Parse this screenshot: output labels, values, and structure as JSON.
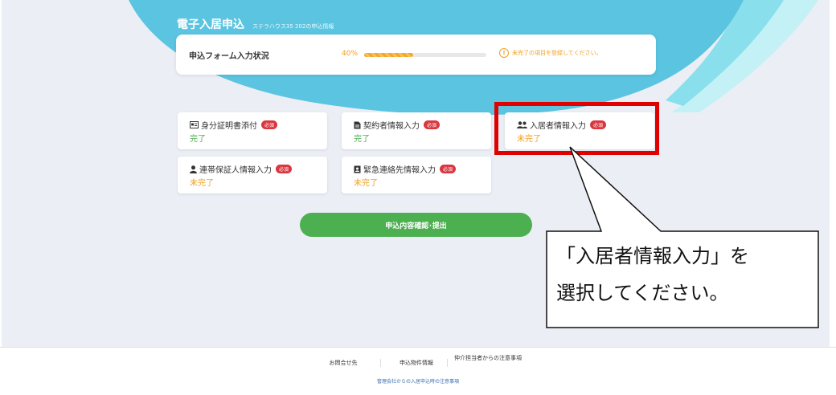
{
  "header": {
    "title": "電子入居申込",
    "subtitle": "ステラハウス35 202の申込情報"
  },
  "progress": {
    "label": "申込フォーム入力状況",
    "percent_text": "40%",
    "percent": 40,
    "warning": "未完了の項目を登録してください。"
  },
  "tasks": [
    {
      "label": "身分証明書添付",
      "badge": "必須",
      "status": "完了",
      "icon": "id-card-icon"
    },
    {
      "label": "契約者情報入力",
      "badge": "必須",
      "status": "完了",
      "icon": "document-icon"
    },
    {
      "label": "入居者情報入力",
      "badge": "必須",
      "status": "未完了",
      "icon": "users-icon"
    },
    {
      "label": "連帯保証人情報入力",
      "badge": "必須",
      "status": "未完了",
      "icon": "user-icon"
    },
    {
      "label": "緊急連絡先情報入力",
      "badge": "必須",
      "status": "未完了",
      "icon": "contact-book-icon"
    }
  ],
  "submit_label": "申込内容確認･提出",
  "callout": {
    "line1": "「入居者情報入力」を",
    "line2": "選択してください。"
  },
  "footer": {
    "links": [
      "お問合せ先",
      "申込物件情報",
      "仲介担当者からの注意事項"
    ],
    "note": "管理会社からの入居申込時の注意事項"
  },
  "colors": {
    "accent_blue": "#5bc4e0",
    "done_green": "#4caf50",
    "todo_orange": "#f0a020",
    "required_red": "#d9363e",
    "highlight_red": "#e00000"
  }
}
